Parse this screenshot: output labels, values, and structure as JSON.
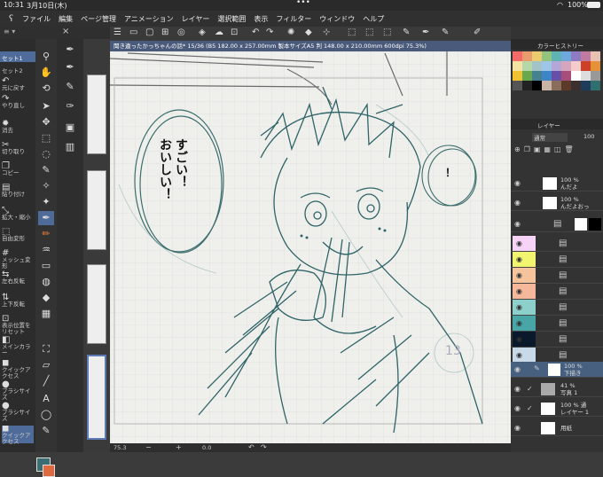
{
  "status": {
    "time": "10:31",
    "date": "3月10日(木)",
    "battery": "100%"
  },
  "menu": [
    "ファイル",
    "編集",
    "ページ管理",
    "アニメーション",
    "レイヤー",
    "選択範囲",
    "表示",
    "フィルター",
    "ウィンドウ",
    "ヘルプ"
  ],
  "left_panel": {
    "tabs": [
      "セット1",
      "セット2"
    ],
    "items": [
      "元に戻す",
      "やり直し",
      "消去",
      "切り取り",
      "コピー",
      "貼り付け",
      "拡大・縮小",
      "自由変形",
      "メッシュ変形",
      "左右反転",
      "上下反転",
      "表示位置をリセット",
      "メインカラー",
      "クイックアクセス",
      "ブラシサイズ",
      "ブラシサイズ",
      "クイックアクセス"
    ]
  },
  "document": {
    "title": "聞き違ったかっちゃんの話* 15/36 (B5 182.00 x 257.00mm 製本サイズA5 判 148.00 x 210.00mm 600dpi 75.3%)"
  },
  "canvas_text": {
    "bubble_col1": "すごい！",
    "bubble_col2": "おいしい！",
    "exclaim": "！",
    "page_number": "13"
  },
  "bottom": {
    "zoom": "75.3",
    "angle": "0.0"
  },
  "right_panel": {
    "color_history_title": "カラーヒストリー",
    "layer_title": "レイヤー",
    "blend_mode": "通常",
    "opacity": "100",
    "layers": [
      {
        "pct": "100 %",
        "name": "んだよ"
      },
      {
        "pct": "100 %",
        "name": "んだよおっ"
      },
      {
        "pct": "100 %",
        "name": "下描き"
      },
      {
        "pct": "41 %",
        "name": "写真 1"
      },
      {
        "pct": "100 % 通",
        "name": "レイヤー 1"
      },
      {
        "pct": "",
        "name": "用紙"
      }
    ]
  },
  "colors": {
    "swatches": [
      "#f26a6a",
      "#e99c6e",
      "#eacb6f",
      "#93c47d",
      "#5fb3b3",
      "#6fa8dc",
      "#8e7cc3",
      "#c27ba0",
      "#e9c1b2",
      "#f5e3a4",
      "#b6d7a8",
      "#a2c4c9",
      "#9fc5e8",
      "#b4a7d6",
      "#d5a6bd",
      "#f4cccc",
      "#cc4125",
      "#e69138",
      "#f1c232",
      "#6aa84f",
      "#45818e",
      "#3d85c6",
      "#674ea7",
      "#a64d79",
      "#ffffff",
      "#dddddd",
      "#999999",
      "#555555",
      "#222222",
      "#000000",
      "#c9b2a6",
      "#8a6d5a",
      "#5b3a29",
      "#3c2f2f",
      "#1f3d5a",
      "#2f6f6f"
    ],
    "layer_tags": [
      "#f7d4f7",
      "#f2f570",
      "#f5c49c",
      "#f5b89a",
      "#8ccfcb",
      "#49a6a6",
      "#0a1a2a",
      "#c8d9e8"
    ]
  }
}
